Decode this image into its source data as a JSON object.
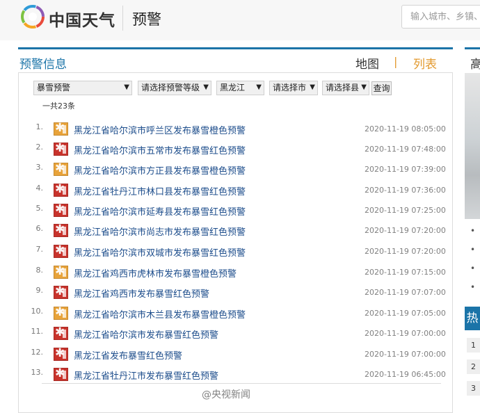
{
  "header": {
    "logo_text": "中国天气",
    "page_title": "预警",
    "search_placeholder": "输入城市、乡镇、"
  },
  "section": {
    "title": "预警信息",
    "view_map": "地图",
    "view_separator": "|",
    "view_list": "列表"
  },
  "filters": {
    "type": "暴雪预警",
    "level": "请选择预警等级",
    "province": "黑龙江",
    "city": "请选择市",
    "county": "请选择县",
    "query_label": "查询"
  },
  "count_text": "一共23条",
  "warnings": [
    {
      "num": "1.",
      "title": "黑龙江省哈尔滨市呼兰区发布暴雪橙色预警",
      "time": "2020-11-19 08:05:00",
      "level": "orange"
    },
    {
      "num": "2.",
      "title": "黑龙江省哈尔滨市五常市发布暴雪红色预警",
      "time": "2020-11-19 07:48:00",
      "level": "red"
    },
    {
      "num": "3.",
      "title": "黑龙江省哈尔滨市方正县发布暴雪橙色预警",
      "time": "2020-11-19 07:39:00",
      "level": "orange"
    },
    {
      "num": "4.",
      "title": "黑龙江省牡丹江市林口县发布暴雪红色预警",
      "time": "2020-11-19 07:36:00",
      "level": "red"
    },
    {
      "num": "5.",
      "title": "黑龙江省哈尔滨市延寿县发布暴雪红色预警",
      "time": "2020-11-19 07:25:00",
      "level": "red"
    },
    {
      "num": "6.",
      "title": "黑龙江省哈尔滨市尚志市发布暴雪红色预警",
      "time": "2020-11-19 07:20:00",
      "level": "red"
    },
    {
      "num": "7.",
      "title": "黑龙江省哈尔滨市双城市发布暴雪红色预警",
      "time": "2020-11-19 07:20:00",
      "level": "red"
    },
    {
      "num": "8.",
      "title": "黑龙江省鸡西市虎林市发布暴雪橙色预警",
      "time": "2020-11-19 07:15:00",
      "level": "orange"
    },
    {
      "num": "9.",
      "title": "黑龙江省鸡西市发布暴雪红色预警",
      "time": "2020-11-19 07:07:00",
      "level": "red"
    },
    {
      "num": "10.",
      "title": "黑龙江省哈尔滨市木兰县发布暴雪橙色预警",
      "time": "2020-11-19 07:05:00",
      "level": "orange"
    },
    {
      "num": "11.",
      "title": "黑龙江省哈尔滨市发布暴雪红色预警",
      "time": "2020-11-19 07:00:00",
      "level": "red"
    },
    {
      "num": "12.",
      "title": "黑龙江省发布暴雪红色预警",
      "time": "2020-11-19 07:00:00",
      "level": "red"
    },
    {
      "num": "13.",
      "title": "黑龙江省牡丹江市发布暴雪红色预警",
      "time": "2020-11-19 06:45:00",
      "level": "red"
    }
  ],
  "sidebar": {
    "heading": "高",
    "hot_label": "热",
    "ranks": [
      "1",
      "2",
      "3"
    ]
  },
  "watermark": "@央视新闻",
  "colors": {
    "brand_blue": "#1b74a8",
    "accent_orange": "#e39a2f",
    "link_blue": "#1e4e8c",
    "warning_orange": "#e8a33a",
    "warning_red": "#c8332c"
  }
}
